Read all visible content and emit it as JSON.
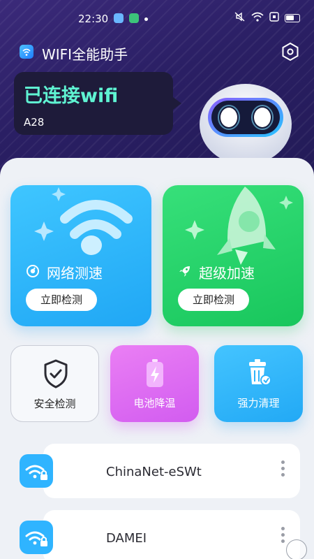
{
  "status_bar": {
    "time": "22:30"
  },
  "header": {
    "app_title": "WIFI全能助手"
  },
  "connection": {
    "status_text": "已连接wifi",
    "ssid": "A28"
  },
  "feature_cards": [
    {
      "label": "网络测速",
      "button": "立即检测",
      "color": "#2bb4fb"
    },
    {
      "label": "超级加速",
      "button": "立即检测",
      "color": "#22cf68"
    }
  ],
  "tools": [
    {
      "label": "安全检测",
      "color": "#f6f8fb"
    },
    {
      "label": "电池降温",
      "color": "#de6ff2"
    },
    {
      "label": "强力清理",
      "color": "#2fb4fb"
    }
  ],
  "wifi_list": [
    {
      "name": "ChinaNet-eSWt",
      "icon": "wifi-lock-icon"
    },
    {
      "name": "DAMEI",
      "icon": "wifi-lock-icon"
    }
  ]
}
